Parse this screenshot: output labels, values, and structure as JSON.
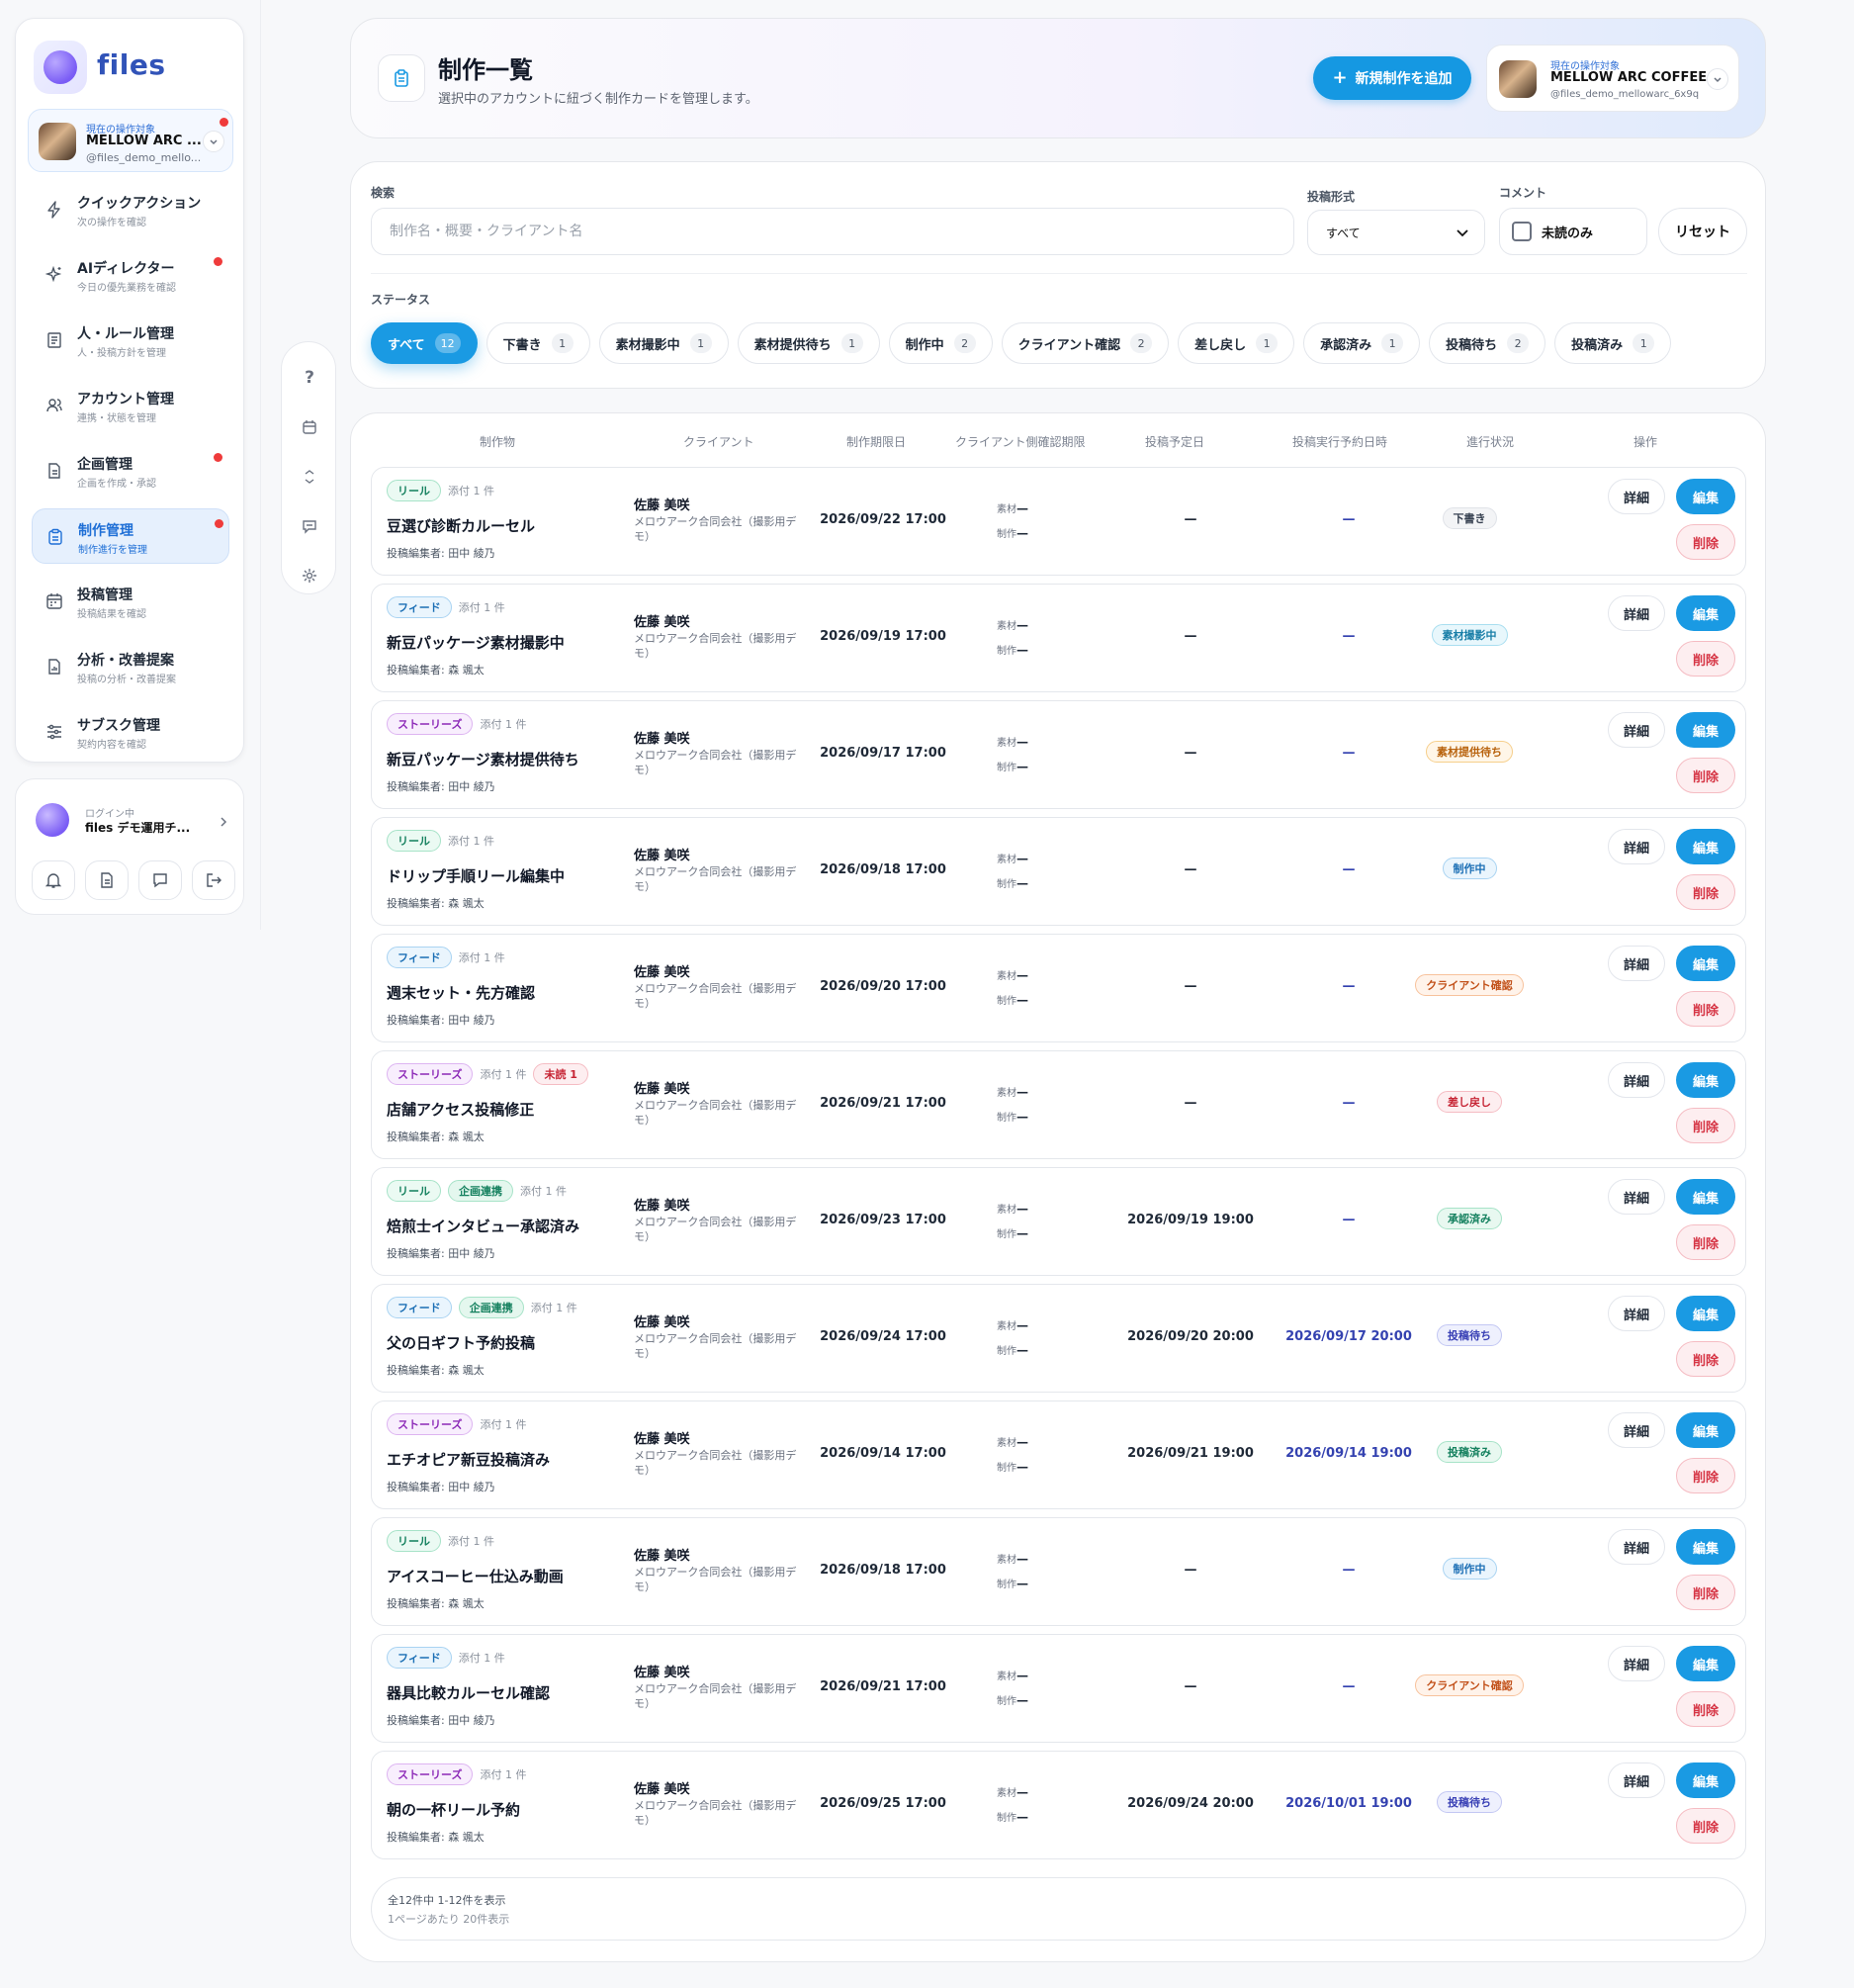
{
  "sidebar": {
    "logo_text": "files",
    "account": {
      "label": "現在の操作対象",
      "name": "MELLOW ARC ...",
      "handle": "@files_demo_mello..."
    },
    "items": [
      {
        "title": "クイックアクション",
        "sub": "次の操作を確認",
        "icon": "bolt-icon",
        "dot": false,
        "active": false
      },
      {
        "title": "AIディレクター",
        "sub": "今日の優先業務を確認",
        "icon": "sparkle-icon",
        "dot": true,
        "active": false
      },
      {
        "title": "人・ルール管理",
        "sub": "人・投稿方針を管理",
        "icon": "rules-icon",
        "dot": false,
        "active": false
      },
      {
        "title": "アカウント管理",
        "sub": "連携・状態を管理",
        "icon": "users-icon",
        "dot": false,
        "active": false
      },
      {
        "title": "企画管理",
        "sub": "企画を作成・承認",
        "icon": "document-icon",
        "dot": true,
        "active": false
      },
      {
        "title": "制作管理",
        "sub": "制作進行を管理",
        "icon": "clipboard-icon",
        "dot": true,
        "active": true
      },
      {
        "title": "投稿管理",
        "sub": "投稿結果を確認",
        "icon": "calendar-icon",
        "dot": false,
        "active": false
      },
      {
        "title": "分析・改善提案",
        "sub": "投稿の分析・改善提案",
        "icon": "analytics-icon",
        "dot": false,
        "active": false
      },
      {
        "title": "サブスク管理",
        "sub": "契約内容を確認",
        "icon": "sliders-icon",
        "dot": false,
        "active": false
      }
    ],
    "user": {
      "label": "ログイン中",
      "name": "files デモ運用チ..."
    }
  },
  "header": {
    "title": "制作一覧",
    "subtitle": "選択中のアカウントに紐づく制作カードを管理します。",
    "new_button": "新規制作を追加",
    "current": {
      "label": "現在の操作対象",
      "name": "MELLOW ARC COFFEE",
      "handle": "@files_demo_mellowarc_6x9q"
    }
  },
  "filters": {
    "search_label": "検索",
    "search_placeholder": "制作名・概要・クライアント名",
    "format_label": "投稿形式",
    "format_value": "すべて",
    "comment_label": "コメント",
    "unread_only": "未読のみ",
    "reset": "リセット",
    "status_label": "ステータス",
    "statuses": [
      {
        "label": "すべて",
        "count": "12",
        "active": true
      },
      {
        "label": "下書き",
        "count": "1"
      },
      {
        "label": "素材撮影中",
        "count": "1"
      },
      {
        "label": "素材提供待ち",
        "count": "1"
      },
      {
        "label": "制作中",
        "count": "2"
      },
      {
        "label": "クライアント確認",
        "count": "2"
      },
      {
        "label": "差し戻し",
        "count": "1"
      },
      {
        "label": "承認済み",
        "count": "1"
      },
      {
        "label": "投稿待ち",
        "count": "2"
      },
      {
        "label": "投稿済み",
        "count": "1"
      }
    ]
  },
  "table": {
    "columns": [
      "制作物",
      "クライアント",
      "制作期限日",
      "クライアント側確認期限",
      "投稿予定日",
      "投稿実行予約日時",
      "進行状況",
      "操作"
    ],
    "material_label": "素材",
    "production_label": "制作",
    "dash": "—",
    "detail": "詳細",
    "edit": "編集",
    "delete": "削除",
    "rows": [
      {
        "tags": [
          {
            "t": "リール",
            "k": "reel"
          }
        ],
        "attach": "添付 1 件",
        "title": "豆選び診断カルーセル",
        "editor": "投稿編集者: 田中 綾乃",
        "client_name": "佐藤 美咲",
        "client_co": "メロウアーク合同会社（撮影用デモ）",
        "deadline": "2026/09/22 17:00",
        "post_date": "—",
        "reserve": "—",
        "status": "下書き",
        "sk": "draft"
      },
      {
        "tags": [
          {
            "t": "フィード",
            "k": "feed"
          }
        ],
        "attach": "添付 1 件",
        "title": "新豆パッケージ素材撮影中",
        "editor": "投稿編集者: 森 颯太",
        "client_name": "佐藤 美咲",
        "client_co": "メロウアーク合同会社（撮影用デモ）",
        "deadline": "2026/09/19 17:00",
        "post_date": "—",
        "reserve": "—",
        "status": "素材撮影中",
        "sk": "shoot"
      },
      {
        "tags": [
          {
            "t": "ストーリーズ",
            "k": "story"
          }
        ],
        "attach": "添付 1 件",
        "title": "新豆パッケージ素材提供待ち",
        "editor": "投稿編集者: 田中 綾乃",
        "client_name": "佐藤 美咲",
        "client_co": "メロウアーク合同会社（撮影用デモ）",
        "deadline": "2026/09/17 17:00",
        "post_date": "—",
        "reserve": "—",
        "status": "素材提供待ち",
        "sk": "wait"
      },
      {
        "tags": [
          {
            "t": "リール",
            "k": "reel"
          }
        ],
        "attach": "添付 1 件",
        "title": "ドリップ手順リール編集中",
        "editor": "投稿編集者: 森 颯太",
        "client_name": "佐藤 美咲",
        "client_co": "メロウアーク合同会社（撮影用デモ）",
        "deadline": "2026/09/18 17:00",
        "post_date": "—",
        "reserve": "—",
        "status": "制作中",
        "sk": "prod"
      },
      {
        "tags": [
          {
            "t": "フィード",
            "k": "feed"
          }
        ],
        "attach": "添付 1 件",
        "title": "週末セット・先方確認",
        "editor": "投稿編集者: 田中 綾乃",
        "client_name": "佐藤 美咲",
        "client_co": "メロウアーク合同会社（撮影用デモ）",
        "deadline": "2026/09/20 17:00",
        "post_date": "—",
        "reserve": "—",
        "status": "クライアント確認",
        "sk": "client"
      },
      {
        "tags": [
          {
            "t": "ストーリーズ",
            "k": "story"
          }
        ],
        "attach": "添付 1 件",
        "unread": "未読 1",
        "title": "店舗アクセス投稿修正",
        "editor": "投稿編集者: 森 颯太",
        "client_name": "佐藤 美咲",
        "client_co": "メロウアーク合同会社（撮影用デモ）",
        "deadline": "2026/09/21 17:00",
        "post_date": "—",
        "reserve": "—",
        "status": "差し戻し",
        "sk": "back"
      },
      {
        "tags": [
          {
            "t": "リール",
            "k": "reel"
          },
          {
            "t": "企画連携",
            "k": "plan"
          }
        ],
        "attach": "添付 1 件",
        "title": "焙煎士インタビュー承認済み",
        "editor": "投稿編集者: 田中 綾乃",
        "client_name": "佐藤 美咲",
        "client_co": "メロウアーク合同会社（撮影用デモ）",
        "deadline": "2026/09/23 17:00",
        "post_date": "2026/09/19 19:00",
        "reserve": "—",
        "status": "承認済み",
        "sk": "appr"
      },
      {
        "tags": [
          {
            "t": "フィード",
            "k": "feed"
          },
          {
            "t": "企画連携",
            "k": "plan"
          }
        ],
        "attach": "添付 1 件",
        "title": "父の日ギフト予約投稿",
        "editor": "投稿編集者: 森 颯太",
        "client_name": "佐藤 美咲",
        "client_co": "メロウアーク合同会社（撮影用デモ）",
        "deadline": "2026/09/24 17:00",
        "post_date": "2026/09/20 20:00",
        "reserve": "2026/09/17 20:00",
        "status": "投稿待ち",
        "sk": "post"
      },
      {
        "tags": [
          {
            "t": "ストーリーズ",
            "k": "story"
          }
        ],
        "attach": "添付 1 件",
        "title": "エチオピア新豆投稿済み",
        "editor": "投稿編集者: 田中 綾乃",
        "client_name": "佐藤 美咲",
        "client_co": "メロウアーク合同会社（撮影用デモ）",
        "deadline": "2026/09/14 17:00",
        "post_date": "2026/09/21 19:00",
        "reserve": "2026/09/14 19:00",
        "status": "投稿済み",
        "sk": "done"
      },
      {
        "tags": [
          {
            "t": "リール",
            "k": "reel"
          }
        ],
        "attach": "添付 1 件",
        "title": "アイスコーヒー仕込み動画",
        "editor": "投稿編集者: 森 颯太",
        "client_name": "佐藤 美咲",
        "client_co": "メロウアーク合同会社（撮影用デモ）",
        "deadline": "2026/09/18 17:00",
        "post_date": "—",
        "reserve": "—",
        "status": "制作中",
        "sk": "prod"
      },
      {
        "tags": [
          {
            "t": "フィード",
            "k": "feed"
          }
        ],
        "attach": "添付 1 件",
        "title": "器具比較カルーセル確認",
        "editor": "投稿編集者: 田中 綾乃",
        "client_name": "佐藤 美咲",
        "client_co": "メロウアーク合同会社（撮影用デモ）",
        "deadline": "2026/09/21 17:00",
        "post_date": "—",
        "reserve": "—",
        "status": "クライアント確認",
        "sk": "client"
      },
      {
        "tags": [
          {
            "t": "ストーリーズ",
            "k": "story"
          }
        ],
        "attach": "添付 1 件",
        "title": "朝の一杯リール予約",
        "editor": "投稿編集者: 森 颯太",
        "client_name": "佐藤 美咲",
        "client_co": "メロウアーク合同会社（撮影用デモ）",
        "deadline": "2026/09/25 17:00",
        "post_date": "2026/09/24 20:00",
        "reserve": "2026/10/01 19:00",
        "status": "投稿待ち",
        "sk": "post"
      }
    ],
    "footer_count": "全12件中 1-12件を表示",
    "footer_per_page": "1ページあたり 20件表示"
  }
}
